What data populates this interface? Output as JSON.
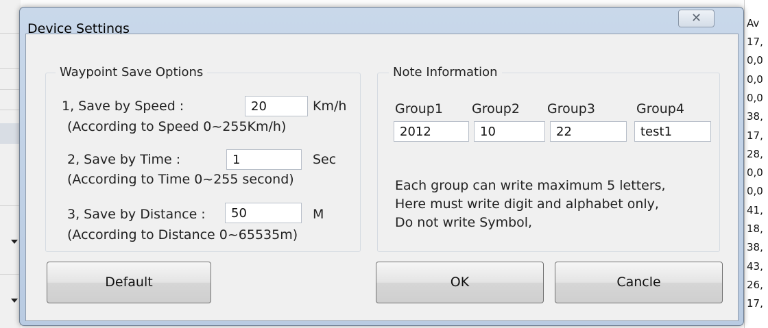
{
  "dialog": {
    "title": "Device Settings",
    "close_glyph": "✕"
  },
  "waypoint": {
    "legend": "Waypoint Save Options",
    "speed_label": "1, Save by Speed :",
    "speed_value": "20",
    "speed_unit": "Km/h",
    "speed_hint": "(According to Speed 0~255Km/h)",
    "time_label": "2, Save by Time :",
    "time_value": "1",
    "time_unit": "Sec",
    "time_hint": "(According to Time 0~255 second)",
    "distance_label": "3, Save by Distance :",
    "distance_value": "50",
    "distance_unit": "M",
    "distance_hint": "(According to Distance 0~65535m)"
  },
  "note": {
    "legend": "Note Information",
    "group_labels": [
      "Group1",
      "Group2",
      "Group3",
      "Group4"
    ],
    "group_values": [
      "2012",
      "10",
      "22",
      "test1"
    ],
    "info_lines": [
      "Each group can write maximum 5 letters,",
      "Here must write digit and alphabet only,",
      "Do not write Symbol,"
    ]
  },
  "buttons": {
    "default": "Default",
    "ok": "OK",
    "cancel": "Cancle"
  },
  "background": {
    "right_column": [
      "Av",
      "17,",
      "0,0",
      "0,0",
      "0,0",
      "38,",
      "17,",
      "28,",
      "0,0",
      "0,0",
      "41,",
      "18,",
      "38,",
      "43,",
      "26,",
      "17,"
    ]
  },
  "colors": {
    "dialog_frame": "#c9d8ea",
    "client_bg": "#f0f0f0",
    "group_border": "#d5dbe2"
  }
}
